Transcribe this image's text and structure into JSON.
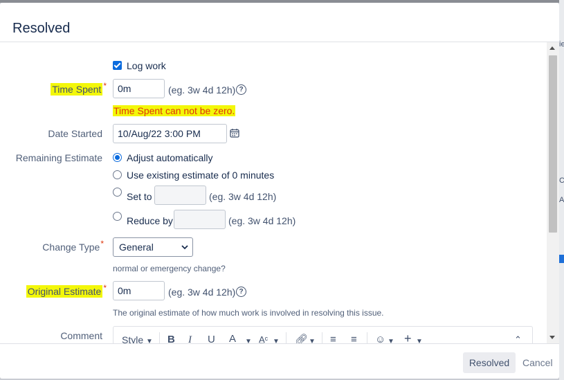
{
  "dialog": {
    "title": "Resolved"
  },
  "backdrop": {
    "fragments": [
      "ie",
      "C",
      "A"
    ]
  },
  "form": {
    "log_work": {
      "label": "Log work",
      "checked": true
    },
    "time_spent": {
      "label": "Time Spent",
      "required_mark": "*",
      "value": "0m",
      "hint": "(eg. 3w 4d 12h)",
      "error": "Time Spent can not be zero."
    },
    "date_started": {
      "label": "Date Started",
      "value": "10/Aug/22 3:00 PM"
    },
    "remaining_estimate": {
      "label": "Remaining Estimate",
      "options": [
        {
          "label": "Adjust automatically",
          "selected": true
        },
        {
          "label": "Use existing estimate of 0 minutes",
          "selected": false
        },
        {
          "label": "Set to",
          "selected": false,
          "hint": "(eg. 3w 4d 12h)"
        },
        {
          "label": "Reduce by",
          "selected": false,
          "hint": "(eg. 3w 4d 12h)"
        }
      ]
    },
    "change_type": {
      "label": "Change Type",
      "required_mark": "*",
      "value": "General",
      "description": "normal or emergency change?"
    },
    "original_estimate": {
      "label": "Original Estimate",
      "required_mark": "*",
      "value": "0m",
      "hint": "(eg. 3w 4d 12h)",
      "description": "The original estimate of how much work is involved in resolving this issue."
    },
    "comment": {
      "label": "Comment",
      "toolbar": {
        "style_label": "Style"
      }
    }
  },
  "footer": {
    "submit_label": "Resolved",
    "cancel_label": "Cancel"
  },
  "colors": {
    "accent": "#0b6bde",
    "error": "#de350b",
    "highlight": "#f3f70a"
  }
}
